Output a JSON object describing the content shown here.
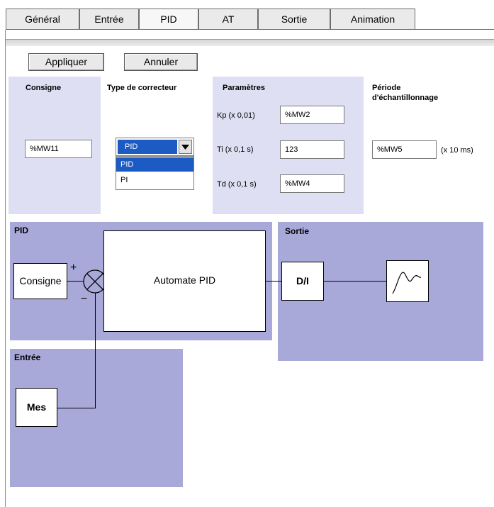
{
  "tabs": [
    {
      "label": "Général"
    },
    {
      "label": "Entrée"
    },
    {
      "label": "PID",
      "active": true
    },
    {
      "label": "AT"
    },
    {
      "label": "Sortie"
    },
    {
      "label": "Animation"
    }
  ],
  "buttons": {
    "apply": "Appliquer",
    "cancel": "Annuler"
  },
  "settings": {
    "setpoint": {
      "header": "Consigne",
      "value": "%MW11"
    },
    "corrector": {
      "header": "Type de correcteur",
      "selected": "PID",
      "options": [
        "PID",
        "PI"
      ]
    },
    "parameters": {
      "header": "Paramètres",
      "kp": {
        "label": "Kp (x 0,01)",
        "value": "%MW2"
      },
      "ti": {
        "label": "Ti (x 0,1 s)",
        "value": "123"
      },
      "td": {
        "label": "Td (x 0,1 s)",
        "value": "%MW4"
      }
    },
    "sampling": {
      "header_line1": "Période",
      "header_line2": "d'échantillonnage",
      "value": "%MW5",
      "unit": "(x 10 ms)"
    }
  },
  "diagram": {
    "pid_title": "PID",
    "output_title": "Sortie",
    "input_title": "Entrée",
    "setpoint_block": "Consigne",
    "controller_block": "Automate  PID",
    "da_block": "D/I",
    "measure_block": "Mes",
    "plus_sign": "+",
    "minus_sign": "−"
  },
  "colors": {
    "panel_light": "#dedff2",
    "panel_dark": "#a8a9d9",
    "select_highlight": "#1c5bc4"
  }
}
